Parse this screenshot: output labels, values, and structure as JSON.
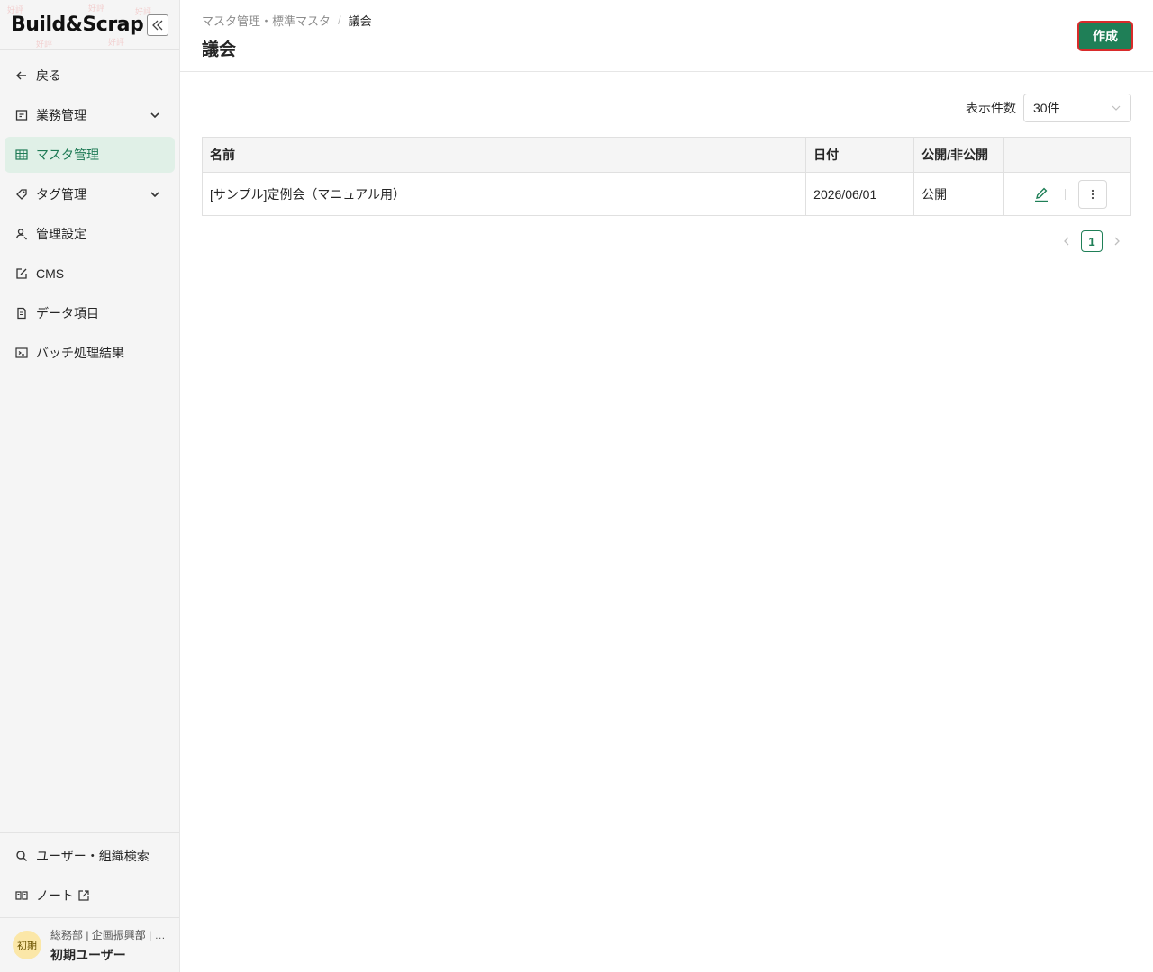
{
  "sidebar": {
    "logo": "Build&Scrap",
    "collapse_icon": "double-chevron-left-icon",
    "items": [
      {
        "label": "戻る",
        "icon": "arrow-left-icon"
      },
      {
        "label": "業務管理",
        "icon": "briefcase-icon",
        "expand_icon": "chevron-down-icon"
      },
      {
        "label": "マスタ管理",
        "icon": "table-icon",
        "active": true
      },
      {
        "label": "タグ管理",
        "icon": "tag-icon",
        "expand_icon": "chevron-down-icon"
      },
      {
        "label": "管理設定",
        "icon": "user-settings-icon"
      },
      {
        "label": "CMS",
        "icon": "edit-icon"
      },
      {
        "label": "データ項目",
        "icon": "document-icon"
      },
      {
        "label": "バッチ処理結果",
        "icon": "terminal-icon"
      }
    ],
    "bottom": [
      {
        "label": "ユーザー・組織検索",
        "icon": "search-icon"
      },
      {
        "label": "ノート",
        "icon": "book-icon",
        "trailing_icon": "external-link-icon"
      }
    ],
    "user": {
      "avatar": "初期",
      "org": "総務部 | 企画振興部 | 情報政策課",
      "name": "初期ユーザー"
    }
  },
  "header": {
    "breadcrumb": [
      "マスタ管理・標準マスタ",
      "議会"
    ],
    "breadcrumb_sep": "/",
    "title": "議会",
    "create_label": "作成"
  },
  "toolbar": {
    "page_size_label": "表示件数",
    "page_size_value": "30件",
    "select_icon": "chevron-down-icon"
  },
  "table": {
    "columns": [
      "名前",
      "日付",
      "公開/非公開",
      ""
    ],
    "rows": [
      {
        "name": "[サンプル]定例会（マニュアル用）",
        "date": "2026/06/01",
        "status": "公開",
        "edit_icon": "pencil-icon",
        "more_icon": "vertical-ellipsis-icon"
      }
    ]
  },
  "pagination": {
    "prev_icon": "chevron-left-icon",
    "current_page": "1",
    "next_icon": "chevron-right-icon"
  },
  "colors": {
    "primary": "#1f7f57",
    "active_bg": "#e0f0e7",
    "focus_border": "#d92b2b"
  }
}
